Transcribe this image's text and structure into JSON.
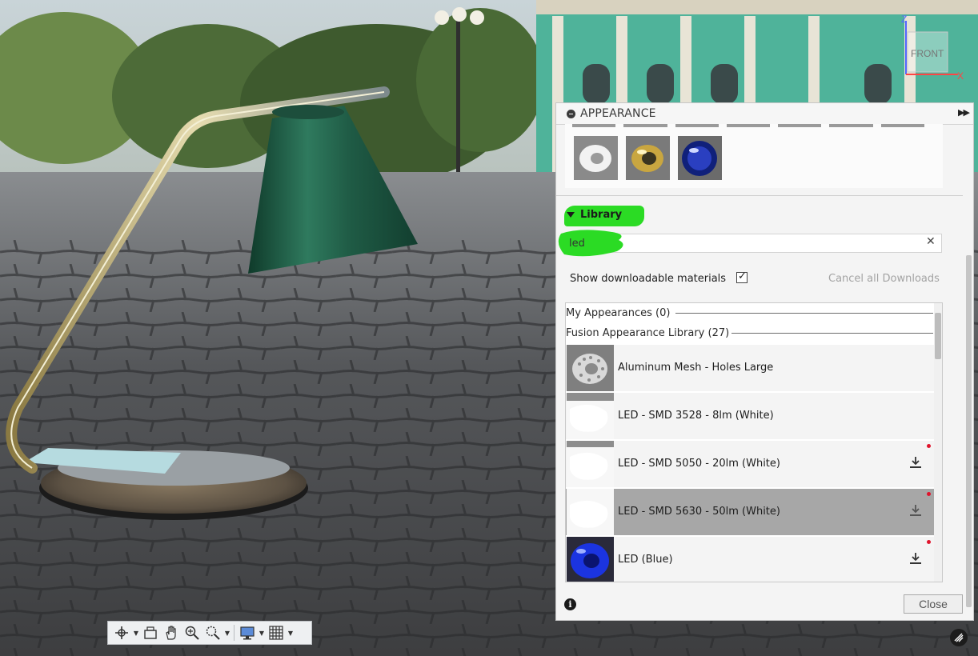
{
  "viewcube": {
    "face_label": "FRONT",
    "axis_z": "Z",
    "axis_x": "X"
  },
  "toolbar": {
    "items": [
      {
        "name": "orbit-icon"
      },
      {
        "name": "look-at-icon"
      },
      {
        "name": "pan-icon"
      },
      {
        "name": "zoom-icon"
      },
      {
        "name": "fit-icon"
      },
      {
        "name": "display-settings-icon"
      },
      {
        "name": "grid-settings-icon"
      }
    ]
  },
  "panel": {
    "title": "APPEARANCE",
    "library_label": "Library",
    "search": {
      "value": "led",
      "placeholder": ""
    },
    "show_downloadable_label": "Show downloadable materials",
    "show_downloadable_checked": true,
    "cancel_downloads_label": "Cancel all Downloads",
    "groups": [
      {
        "label": "My Appearances (0)"
      },
      {
        "label": "Fusion Appearance Library (27)"
      }
    ],
    "items": [
      {
        "label": "Aluminum Mesh - Holes Large",
        "downloadable": false,
        "selected": false
      },
      {
        "label": "LED - SMD 3528 - 8lm (White)",
        "downloadable": false,
        "selected": false
      },
      {
        "label": "LED - SMD 5050 - 20lm (White)",
        "downloadable": true,
        "selected": false
      },
      {
        "label": "LED - SMD 5630 - 50lm (White)",
        "downloadable": true,
        "selected": true
      },
      {
        "label": "LED (Blue)",
        "downloadable": true,
        "selected": false
      }
    ],
    "close_label": "Close"
  },
  "colors": {
    "highlight": "#2bdb24",
    "lamp_shade": "#1e5a44",
    "selected_row": "#a7a7a7"
  }
}
